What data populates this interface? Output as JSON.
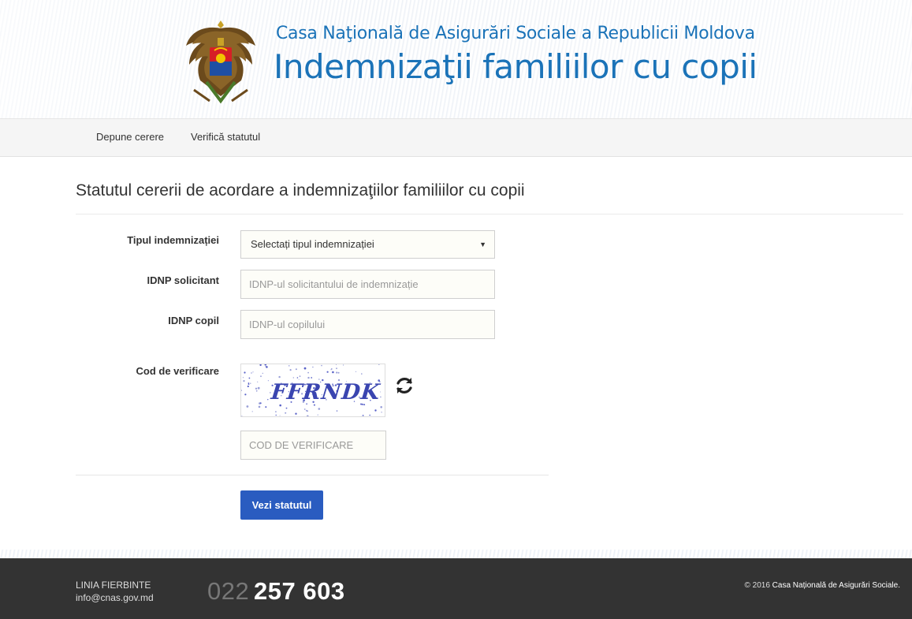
{
  "header": {
    "subtitle": "Casa Naţională de Asigurări Sociale a Republicii Moldova",
    "title": "Indemnizaţii familiilor cu copii"
  },
  "nav": {
    "items": [
      {
        "label": "Depune cerere"
      },
      {
        "label": "Verifică statutul"
      }
    ]
  },
  "main": {
    "page_title": "Statutul cererii de acordare a indemnizaţiilor familiilor cu copii",
    "form": {
      "type_label": "Tipul indemnizației",
      "type_selected": "Selectați tipul indemnizației",
      "idnp_applicant_label": "IDNP solicitant",
      "idnp_applicant_placeholder": "IDNP-ul solicitantului de indemnizație",
      "idnp_child_label": "IDNP copil",
      "idnp_child_placeholder": "IDNP-ul copilului",
      "captcha_label": "Cod de verificare",
      "captcha_text": "FFRNDK",
      "captcha_placeholder": "COD DE VERIFICARE",
      "submit_label": "Vezi statutul"
    }
  },
  "footer": {
    "hotline_label": "LINIA FIERBINTE",
    "email": "info@cnas.gov.md",
    "phone_prefix": "022",
    "phone_number": "257 603",
    "copyright_prefix": "© 2016",
    "copyright_org": "Casa Naționalǎ de Asigurări Sociale."
  },
  "colors": {
    "brand_blue": "#1b73b8",
    "button_blue": "#2a5cc0",
    "footer_bg": "#333333"
  },
  "icons": {
    "crest": "moldova-coat-of-arms",
    "refresh": "refresh-icon",
    "select_arrow": "caret-down-icon"
  }
}
